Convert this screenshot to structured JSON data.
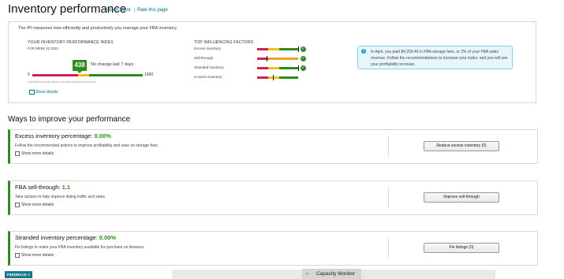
{
  "header": {
    "title": "Inventory performance",
    "learn_more": "Learn more",
    "separator": "|",
    "rate_page": "Rate this page"
  },
  "ipi_panel": {
    "intro": "The IPI measures how efficiently and productively you manage your FBA inventory.",
    "index_label": "YOUR INVENTORY PERFORMANCE INDEX",
    "week_label": "FOR WEEK 22 2023",
    "score": "438",
    "score_fraction": 0.438,
    "no_change": "No change last 7 days",
    "scale_min": "0",
    "scale_max": "1000",
    "updated_note": "Updated weekly based on historical performance",
    "show_details": "Show details",
    "factors_label": "TOP INFLUENCING FACTORS",
    "factors": [
      {
        "label": "Excess inventory",
        "status": "check"
      },
      {
        "label": "Sell-through",
        "status": "check"
      },
      {
        "label": "Stranded inventory",
        "status": "check"
      },
      {
        "label": "In-stock inventory",
        "status": "none"
      }
    ],
    "alert": "In April, you paid $4,269.45 in FBA storage fees, or 2% of your FBA sales revenue. Follow the recommendations to increase your index, and you will see your profitability increase."
  },
  "improve": {
    "section_title": "Ways to improve your performance",
    "cards": [
      {
        "title": "Excess inventory percentage:",
        "value": "0.00%",
        "desc": "Follow the recommended actions to improve profitability and save on storage fees.",
        "show_more": "Show more details",
        "button": "Reduce excess inventory (0)"
      },
      {
        "title": "FBA sell-through:",
        "value": "1.1",
        "desc": "Take actions to help improve listing traffic and sales",
        "show_more": "Show more details",
        "button": "Improve sell-through"
      },
      {
        "title": "Stranded inventory percentage:",
        "value": "0.00%",
        "desc": "Fix listings to make your FBA inventory available for purchase on Amazon.",
        "show_more": "Show more details",
        "button": "Fix listings (0)"
      }
    ]
  },
  "footer": {
    "feedback": "FEEDBACK",
    "feedback_symbol": "×",
    "capacity_monitor": "Capacity Monitor"
  },
  "colors": {
    "accent_green": "#2e8b1f",
    "link": "#007185",
    "red": "#d1214f",
    "yellow": "#f1c21b",
    "orange": "#f0a020"
  }
}
